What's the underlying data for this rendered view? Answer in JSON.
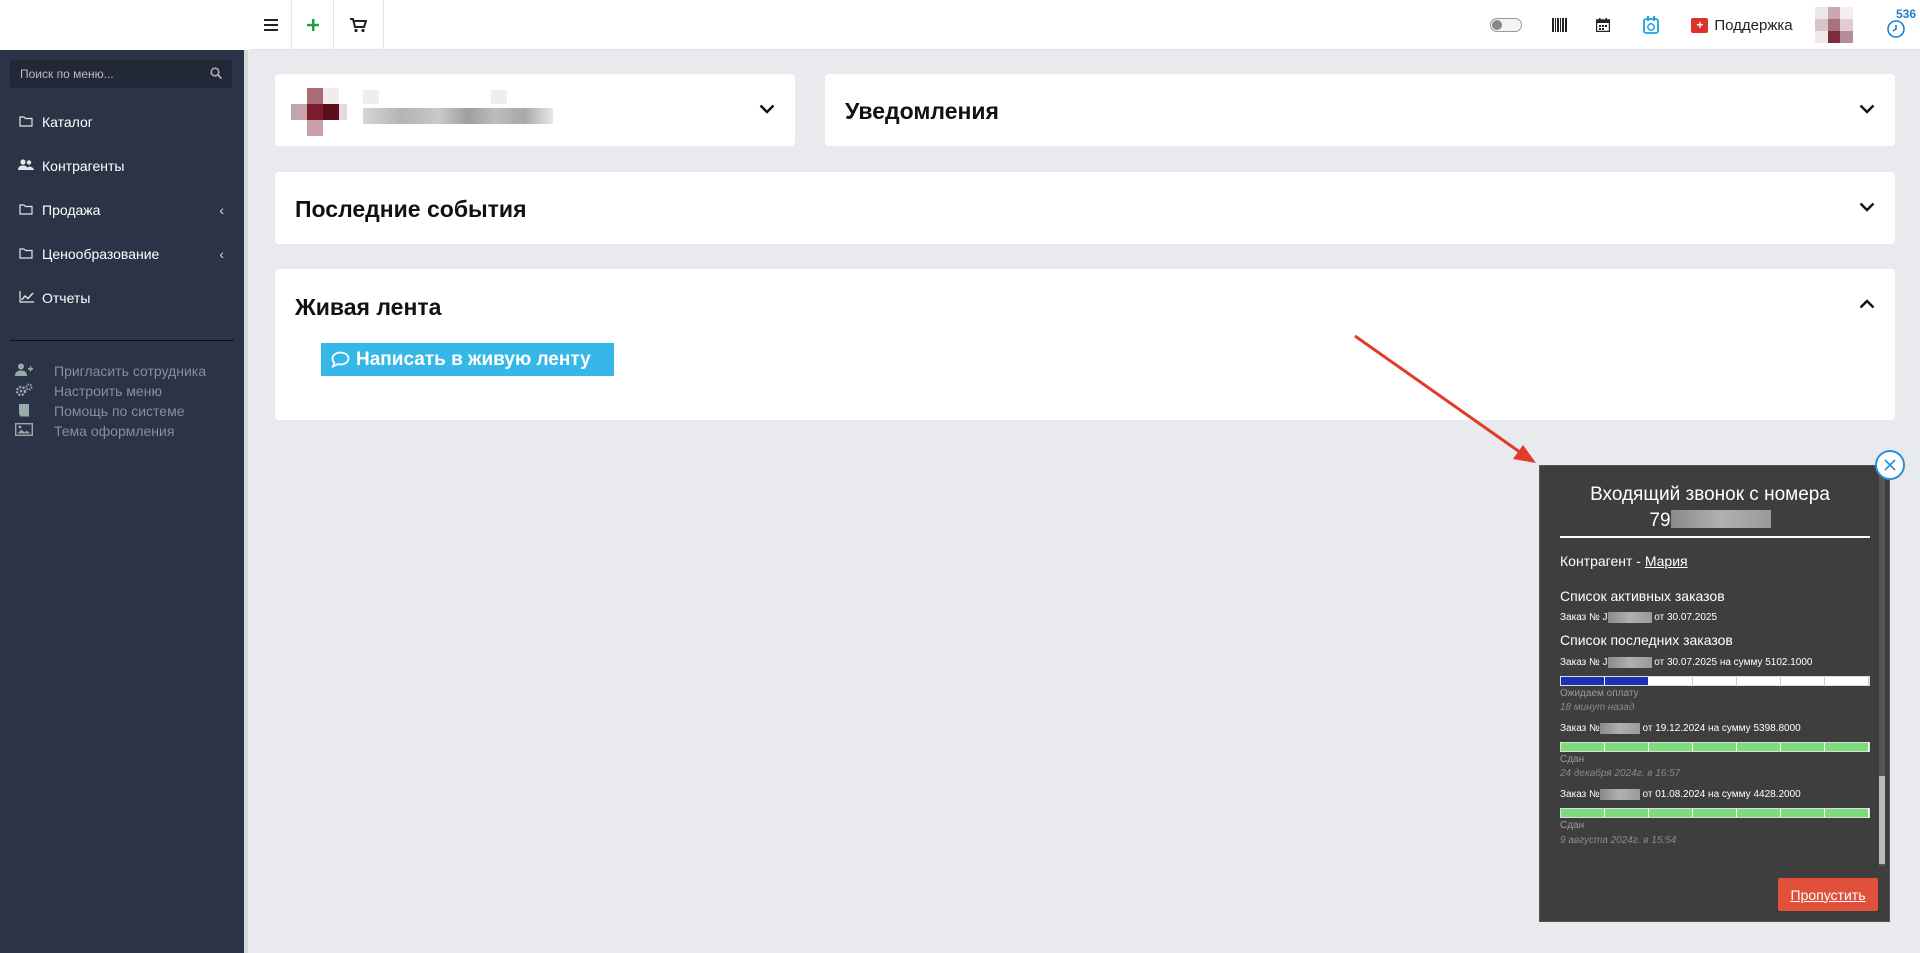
{
  "topbar": {
    "menu_icon": "menu-icon",
    "add_icon": "plus-icon",
    "cart_icon": "cart-icon",
    "support_label": "Поддержка",
    "badge_count": "536"
  },
  "sidebar": {
    "search_placeholder": "Поиск по меню...",
    "items": [
      {
        "label": "Каталог",
        "icon": "folder-icon",
        "has_submenu": false
      },
      {
        "label": "Контрагенты",
        "icon": "users-icon",
        "has_submenu": false
      },
      {
        "label": "Продажа",
        "icon": "folder-icon",
        "has_submenu": true
      },
      {
        "label": "Ценообразование",
        "icon": "folder-icon",
        "has_submenu": true
      },
      {
        "label": "Отчеты",
        "icon": "chart-line-icon",
        "has_submenu": false
      }
    ],
    "utility": [
      {
        "label": "Пригласить сотрудника",
        "icon": "user-plus-icon"
      },
      {
        "label": "Настроить меню",
        "icon": "gears-icon"
      },
      {
        "label": "Помощь по системе",
        "icon": "book-icon"
      },
      {
        "label": "Тема оформления",
        "icon": "image-icon"
      }
    ]
  },
  "panels": {
    "notifications_title": "Уведомления",
    "recent_events_title": "Последние события",
    "live_feed_title": "Живая лента",
    "write_button": "Написать в живую ленту"
  },
  "call_popup": {
    "title": "Входящий звонок с номера",
    "number_prefix": "79",
    "client_label": "Контрагент - ",
    "client_name": "Мария",
    "active_orders_heading": "Список активных заказов",
    "active_order": {
      "prefix": "Заказ № J",
      "date": "от 30.07.2025"
    },
    "recent_orders_heading": "Список последних заказов",
    "recent_orders": [
      {
        "prefix": "Заказ № J",
        "details": "от 30.07.2025 на сумму 5102.1000",
        "status": "Ожидаем оплату",
        "time": "18 минут назад",
        "progress": 0.28,
        "color": "#1c2fb5"
      },
      {
        "prefix": "Заказ №",
        "details": "от 19.12.2024 на сумму 5398.8000",
        "status": "Сдан",
        "time": "24 декабря 2024г. в 16:57",
        "progress": 1.0,
        "color": "#7bdc7b"
      },
      {
        "prefix": "Заказ №",
        "details": "от 01.08.2024 на сумму 4428.2000",
        "status": "Сдан",
        "time": "9 августа 2024г. в 15:54",
        "progress": 1.0,
        "color": "#7bdc7b"
      }
    ],
    "skip_button": "Пропустить"
  }
}
